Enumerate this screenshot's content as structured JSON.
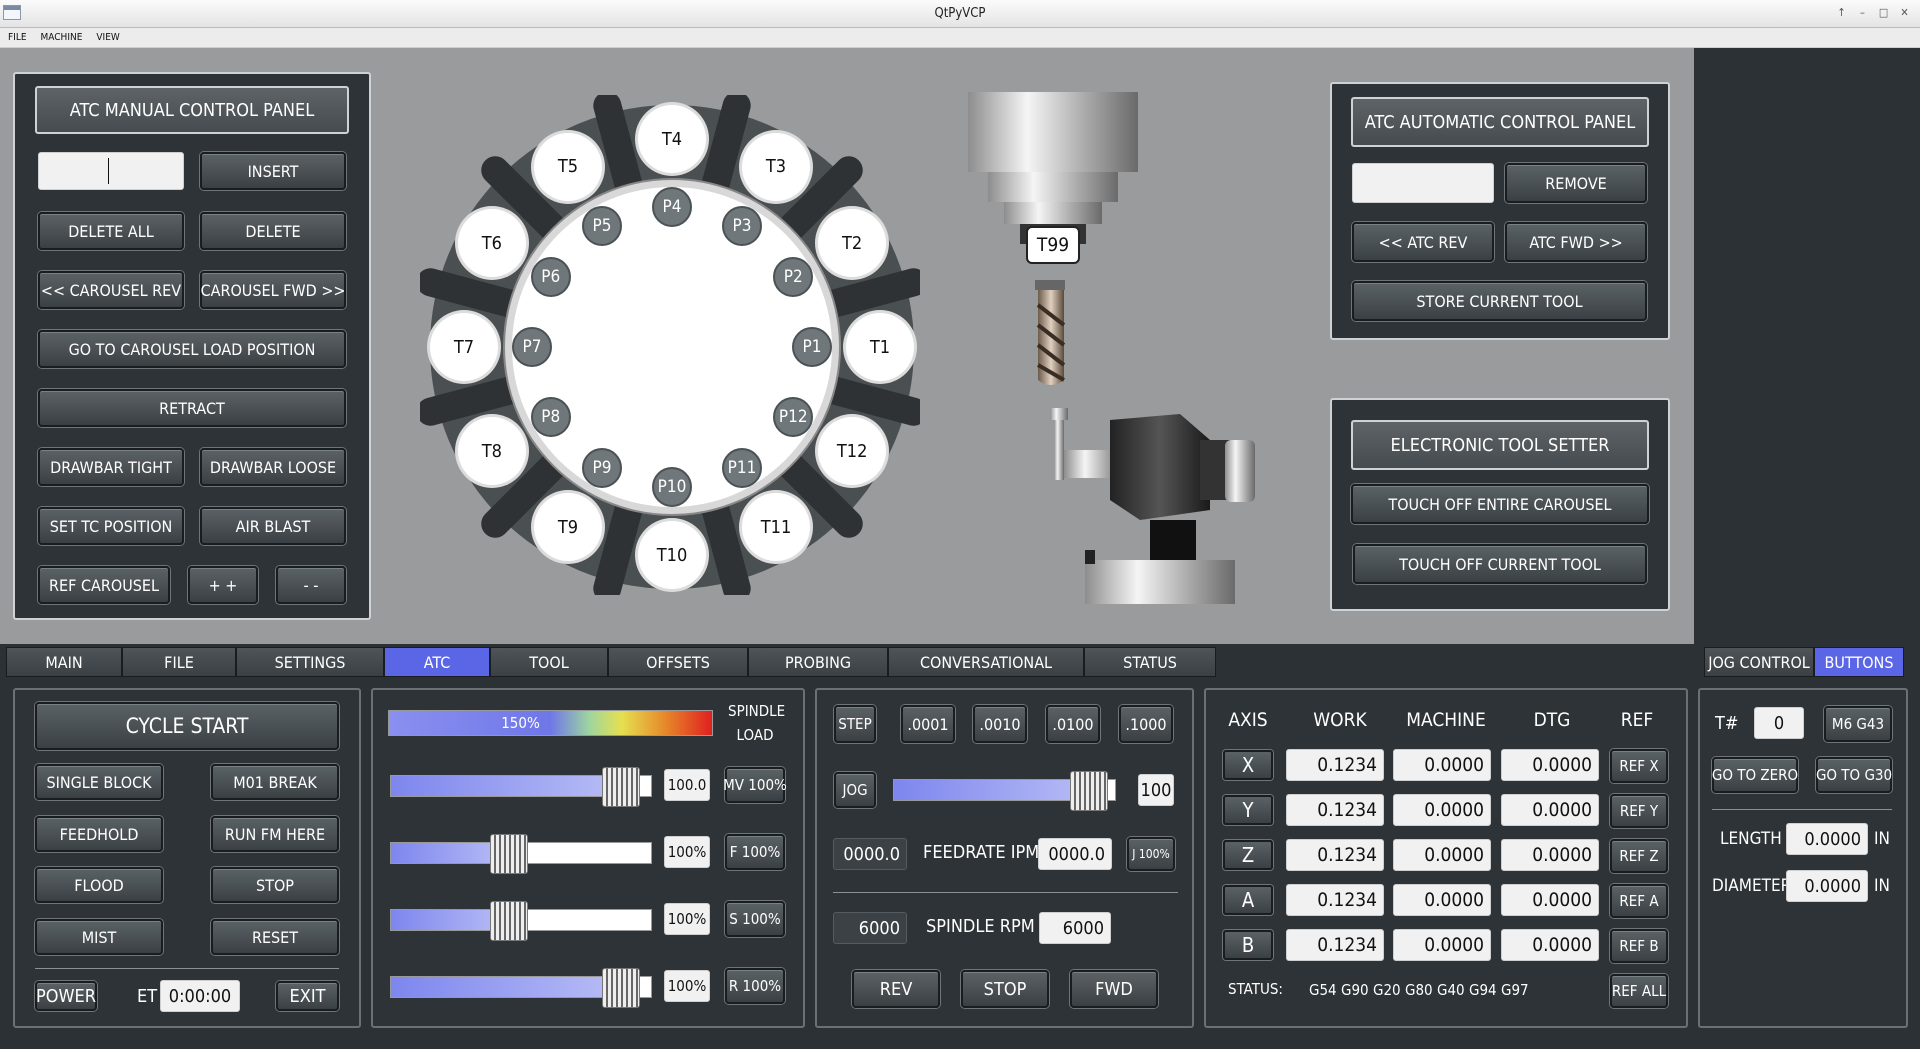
{
  "window": {
    "title": "QtPyVCP",
    "controls": [
      "↑",
      "–",
      "□",
      "✕"
    ]
  },
  "menu": [
    "FILE",
    "MACHINE",
    "VIEW"
  ],
  "manual": {
    "title": "ATC MANUAL CONTROL PANEL",
    "input_value": "",
    "insert": "INSERT",
    "delete_all": "DELETE ALL",
    "delete": "DELETE",
    "carousel_rev": "<< CAROUSEL REV",
    "carousel_fwd": "CAROUSEL FWD >>",
    "load_pos": "GO TO CAROUSEL LOAD POSITION",
    "retract": "RETRACT",
    "drawbar_tight": "DRAWBAR TIGHT",
    "drawbar_loose": "DRAWBAR LOOSE",
    "set_tc": "SET TC POSITION",
    "air_blast": "AIR BLAST",
    "ref_carousel": "REF CAROUSEL",
    "plus": "+ +",
    "minus": "- -"
  },
  "carousel": {
    "tools": [
      "T1",
      "T2",
      "T3",
      "T4",
      "T5",
      "T6",
      "T7",
      "T8",
      "T9",
      "T10",
      "T11",
      "T12"
    ],
    "pockets": [
      "P1",
      "P2",
      "P3",
      "P4",
      "P5",
      "P6",
      "P7",
      "P8",
      "P9",
      "P10",
      "P11",
      "P12"
    ]
  },
  "spindle_tool": "T99",
  "auto": {
    "title": "ATC AUTOMATIC CONTROL PANEL",
    "remove": "REMOVE",
    "atc_rev": "<< ATC REV",
    "atc_fwd": "ATC FWD >>",
    "store": "STORE CURRENT TOOL"
  },
  "setter": {
    "title": "ELECTRONIC TOOL SETTER",
    "touch_all": "TOUCH OFF ENTIRE CAROUSEL",
    "touch_current": "TOUCH OFF CURRENT TOOL"
  },
  "tabs": [
    "MAIN",
    "FILE",
    "SETTINGS",
    "ATC",
    "TOOL",
    "OFFSETS",
    "PROBING",
    "CONVERSATIONAL",
    "STATUS"
  ],
  "active_tab": "ATC",
  "right_tabs": [
    "JOG CONTROL",
    "BUTTONS"
  ],
  "cycle": {
    "start": "CYCLE START",
    "single_block": "SINGLE BLOCK",
    "m01": "M01 BREAK",
    "feedhold": "FEEDHOLD",
    "run_here": "RUN FM HERE",
    "flood": "FLOOD",
    "stop": "STOP",
    "mist": "MIST",
    "reset": "RESET",
    "power": "POWER",
    "et_label": "ET",
    "et_value": "0:00:00",
    "exit": "EXIT"
  },
  "overrides": {
    "load_value": "150%",
    "load_label_1": "SPINDLE",
    "load_label_2": "LOAD",
    "load_level": 1.0,
    "rows": [
      {
        "value": "100.0",
        "btn": "MV 100%",
        "level": 0.86
      },
      {
        "value": "100%",
        "btn": "F 100%",
        "level": 0.43
      },
      {
        "value": "100%",
        "btn": "S 100%",
        "level": 0.43
      },
      {
        "value": "100%",
        "btn": "R 100%",
        "level": 0.86
      }
    ]
  },
  "jog": {
    "step": "STEP",
    "incs": [
      ".0001",
      ".0010",
      ".0100",
      ".1000"
    ],
    "jog": "JOG",
    "jog_value": "100",
    "jog_level": 0.88,
    "feed_left": "0000.0",
    "feed_label": "FEEDRATE IPM",
    "feed_right": "0000.0",
    "j100": "J 100%",
    "rpm_left": "6000",
    "rpm_label": "SPINDLE RPM",
    "rpm_right": "6000",
    "rev": "REV",
    "stop": "STOP",
    "fwd": "FWD"
  },
  "dro": {
    "headers": [
      "AXIS",
      "WORK",
      "MACHINE",
      "DTG",
      "REF"
    ],
    "rows": [
      {
        "axis": "X",
        "work": "0.1234",
        "machine": "0.0000",
        "dtg": "0.0000",
        "ref": "REF X"
      },
      {
        "axis": "Y",
        "work": "0.1234",
        "machine": "0.0000",
        "dtg": "0.0000",
        "ref": "REF Y"
      },
      {
        "axis": "Z",
        "work": "0.1234",
        "machine": "0.0000",
        "dtg": "0.0000",
        "ref": "REF Z"
      },
      {
        "axis": "A",
        "work": "0.1234",
        "machine": "0.0000",
        "dtg": "0.0000",
        "ref": "REF A"
      },
      {
        "axis": "B",
        "work": "0.1234",
        "machine": "0.0000",
        "dtg": "0.0000",
        "ref": "REF B"
      }
    ],
    "status_label": "STATUS:",
    "gcodes": [
      "G54",
      "G90",
      "G20",
      "G80",
      "G40",
      "G94",
      "G97"
    ],
    "ref_all": "REF ALL"
  },
  "toolpanel": {
    "t_label": "T#",
    "t_value": "0",
    "m6": "M6 G43",
    "go_zero": "GO TO ZERO",
    "go_g30": "GO TO G30",
    "length_label": "LENGTH",
    "length_value": "0.0000",
    "length_unit": "IN",
    "dia_label": "DIAMETER",
    "dia_value": "0.0000",
    "dia_unit": "IN"
  }
}
